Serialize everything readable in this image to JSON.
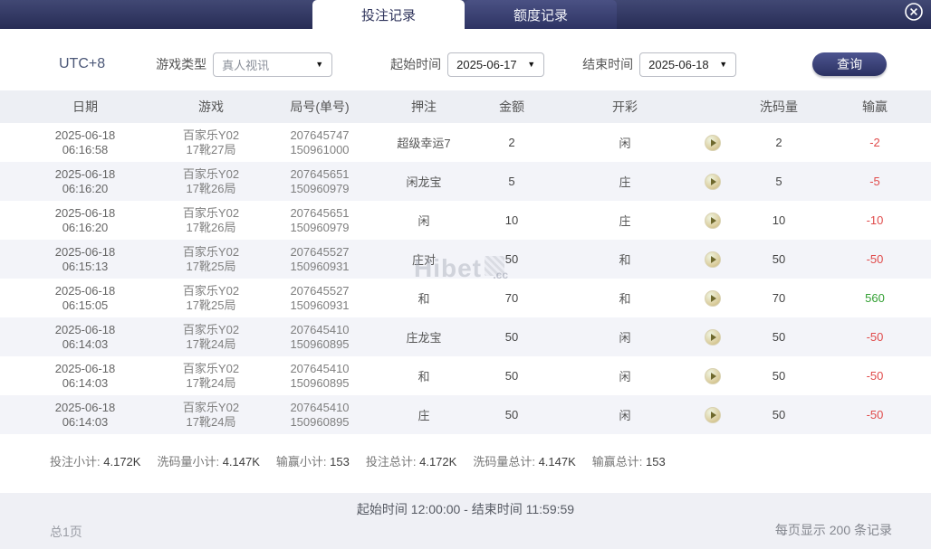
{
  "colors": {
    "navy": "#2b3160",
    "loss_red": "#e04b4b",
    "win_green": "#33a033"
  },
  "header": {
    "tabs": [
      {
        "label": "投注记录",
        "active": true
      },
      {
        "label": "额度记录",
        "active": false
      }
    ],
    "close_icon": "circle-x"
  },
  "filters": {
    "timezone": "UTC+8",
    "game_type_label": "游戏类型",
    "game_type_value": "真人视讯",
    "start_label": "起始时间",
    "start_value": "2025-06-17",
    "end_label": "结束时间",
    "end_value": "2025-06-18",
    "search_label": "查询",
    "caret": "▼"
  },
  "table": {
    "columns": [
      "日期",
      "游戏",
      "局号(单号)",
      "押注",
      "金额",
      "开彩",
      "",
      "洗码量",
      "输赢"
    ],
    "play_icon": "play-circle",
    "rows": [
      {
        "date": "2025-06-18",
        "time": "06:16:58",
        "game_name": "百家乐Y02",
        "game_round": "17靴27局",
        "bet_no": "207645747",
        "order_no": "150961000",
        "bet": "超级幸运7",
        "amount": "2",
        "result": "闲",
        "wash": "2",
        "winloss": "-2"
      },
      {
        "date": "2025-06-18",
        "time": "06:16:20",
        "game_name": "百家乐Y02",
        "game_round": "17靴26局",
        "bet_no": "207645651",
        "order_no": "150960979",
        "bet": "闲龙宝",
        "amount": "5",
        "result": "庄",
        "wash": "5",
        "winloss": "-5"
      },
      {
        "date": "2025-06-18",
        "time": "06:16:20",
        "game_name": "百家乐Y02",
        "game_round": "17靴26局",
        "bet_no": "207645651",
        "order_no": "150960979",
        "bet": "闲",
        "amount": "10",
        "result": "庄",
        "wash": "10",
        "winloss": "-10"
      },
      {
        "date": "2025-06-18",
        "time": "06:15:13",
        "game_name": "百家乐Y02",
        "game_round": "17靴25局",
        "bet_no": "207645527",
        "order_no": "150960931",
        "bet": "庄对",
        "amount": "50",
        "result": "和",
        "wash": "50",
        "winloss": "-50"
      },
      {
        "date": "2025-06-18",
        "time": "06:15:05",
        "game_name": "百家乐Y02",
        "game_round": "17靴25局",
        "bet_no": "207645527",
        "order_no": "150960931",
        "bet": "和",
        "amount": "70",
        "result": "和",
        "wash": "70",
        "winloss": "560"
      },
      {
        "date": "2025-06-18",
        "time": "06:14:03",
        "game_name": "百家乐Y02",
        "game_round": "17靴24局",
        "bet_no": "207645410",
        "order_no": "150960895",
        "bet": "庄龙宝",
        "amount": "50",
        "result": "闲",
        "wash": "50",
        "winloss": "-50"
      },
      {
        "date": "2025-06-18",
        "time": "06:14:03",
        "game_name": "百家乐Y02",
        "game_round": "17靴24局",
        "bet_no": "207645410",
        "order_no": "150960895",
        "bet": "和",
        "amount": "50",
        "result": "闲",
        "wash": "50",
        "winloss": "-50"
      },
      {
        "date": "2025-06-18",
        "time": "06:14:03",
        "game_name": "百家乐Y02",
        "game_round": "17靴24局",
        "bet_no": "207645410",
        "order_no": "150960895",
        "bet": "庄",
        "amount": "50",
        "result": "闲",
        "wash": "50",
        "winloss": "-50"
      }
    ]
  },
  "summary": {
    "items": [
      {
        "label": "投注小计:",
        "value": "4.172K"
      },
      {
        "label": "洗码量小计:",
        "value": "4.147K"
      },
      {
        "label": "输赢小计:",
        "value": "153"
      },
      {
        "label": "投注总计:",
        "value": "4.172K"
      },
      {
        "label": "洗码量总计:",
        "value": "4.147K"
      },
      {
        "label": "输赢总计:",
        "value": "153"
      }
    ]
  },
  "footer": {
    "time_range": "起始时间 12:00:00 - 结束时间 11:59:59",
    "pages": "总1页",
    "per_page": "每页显示 200 条记录"
  },
  "watermark": {
    "text": "Hibet",
    "suffix": ".cc"
  }
}
